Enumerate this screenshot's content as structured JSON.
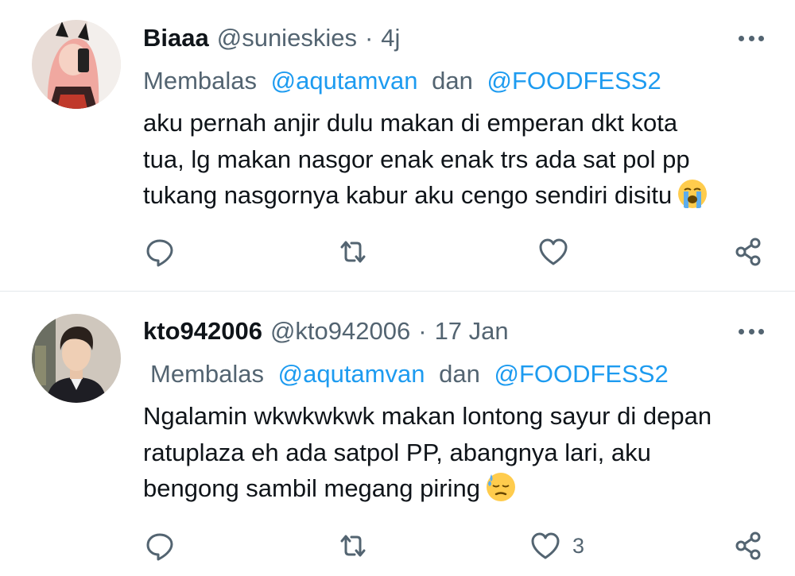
{
  "tweets": [
    {
      "name": "Biaaa",
      "handle": "@sunieskies",
      "separator": "·",
      "time": "4j",
      "reply_prefix": "Membalas",
      "mention_1": "@aqutamvan",
      "reply_and": "dan",
      "mention_2": "@FOODFESS2",
      "body_lines": [
        "aku pernah anjir dulu makan di emperan dkt kota",
        "tua, lg makan nasgor enak enak trs ada sat pol pp",
        "tukang nasgornya kabur aku cengo sendiri disitu"
      ],
      "emoji": "loudly-crying-face-icon",
      "like_count": ""
    },
    {
      "name": "kto942006",
      "handle": "@kto942006",
      "separator": "·",
      "time": "17 Jan",
      "reply_prefix": "Membalas",
      "mention_1": "@aqutamvan",
      "reply_and": "dan",
      "mention_2": "@FOODFESS2",
      "body_lines": [
        "Ngalamin wkwkwkwk makan lontong sayur di depan",
        "ratuplaza eh ada satpol PP, abangnya lari, aku",
        "bengong sambil megang piring"
      ],
      "emoji": "downcast-face-with-sweat-icon",
      "like_count": "3"
    }
  ],
  "colors": {
    "text": "#0f1419",
    "secondary": "#536471",
    "accent": "#1d9bf0",
    "divider": "#e4e8ec"
  }
}
